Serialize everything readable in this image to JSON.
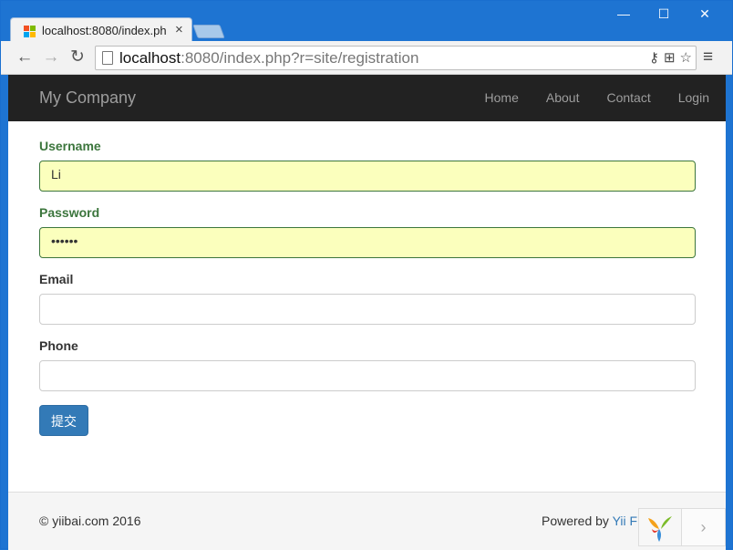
{
  "browser": {
    "tab_title": "localhost:8080/index.ph",
    "tab_close": "×",
    "url_host": "localhost",
    "url_rest": ":8080/index.php?r=site/registration",
    "controls": {
      "minimize": "—",
      "maximize": "☐",
      "close": "✕"
    },
    "nav": {
      "back": "←",
      "forward": "→",
      "reload": "↻",
      "menu": "≡"
    },
    "omni_icons": {
      "key": "⚷",
      "translate": "⊞",
      "star": "☆"
    }
  },
  "navbar": {
    "brand": "My Company",
    "links": [
      "Home",
      "About",
      "Contact",
      "Login"
    ]
  },
  "form": {
    "fields": [
      {
        "label": "Username",
        "value": "Li",
        "state": "success"
      },
      {
        "label": "Password",
        "value": "••••••",
        "state": "success"
      },
      {
        "label": "Email",
        "value": "",
        "state": "default"
      },
      {
        "label": "Phone",
        "value": "",
        "state": "default"
      }
    ],
    "submit_label": "提交"
  },
  "footer": {
    "copyright": "© yiibai.com 2016",
    "powered_prefix": "Powered by ",
    "powered_link": "Yii F",
    "widget_arrow": "›"
  },
  "colors": {
    "titlebar": "#1e74d2",
    "navbar": "#222222",
    "success": "#3c763d",
    "autofill": "#fbffbd",
    "primary": "#337ab7"
  }
}
